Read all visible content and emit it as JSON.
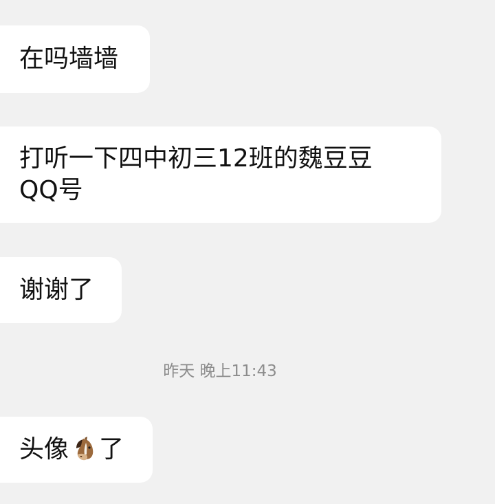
{
  "messages": [
    {
      "text": "在吗墙墙"
    },
    {
      "text": "打听一下四中初三12班的魏豆豆\nQQ号"
    },
    {
      "text": "谢谢了"
    },
    {
      "text_before": "头像",
      "emoji": "horse",
      "text_after": "了"
    }
  ],
  "timestamp": "昨天 晚上11:43",
  "colors": {
    "background": "#f1f1f1",
    "bubble": "#ffffff",
    "timestamp": "#8c8c8c"
  }
}
